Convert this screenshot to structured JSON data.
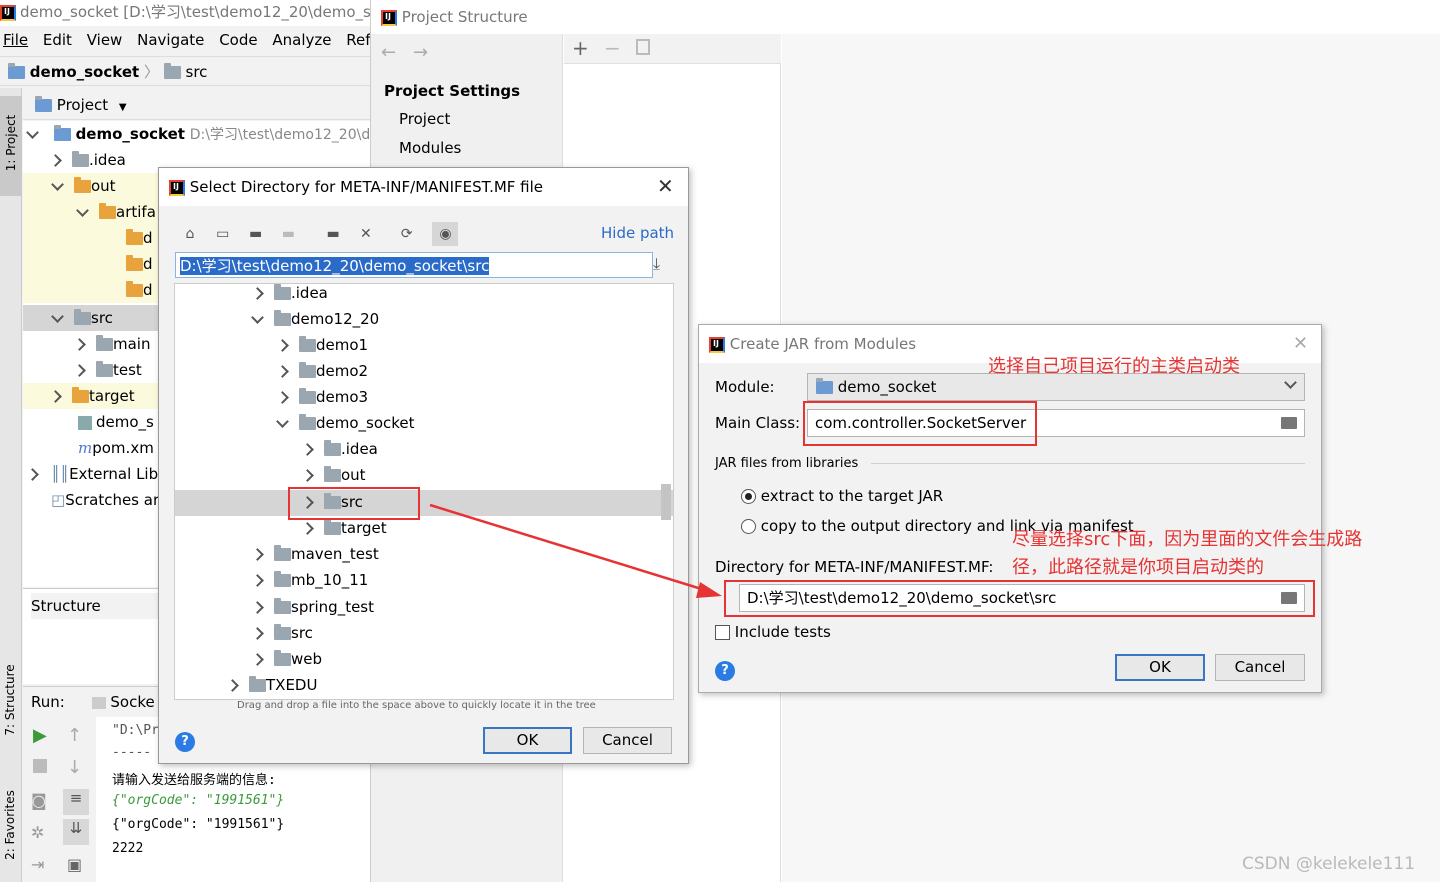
{
  "ide": {
    "title": "demo_socket [D:\\学习\\test\\demo12_20\\demo_s",
    "menu": [
      "File",
      "Edit",
      "View",
      "Navigate",
      "Code",
      "Analyze",
      "Ref"
    ],
    "breadcrumb_project": "demo_socket",
    "breadcrumb_folder": "src",
    "panel_title": "Project",
    "side_tabs": [
      "1: Project",
      "7: Structure",
      "2: Favorites"
    ],
    "tree_root": "demo_socket",
    "tree_root_path": "D:\\学习\\test\\demo12_20\\d",
    "tree": [
      ".idea",
      "out",
      "artifa",
      "d",
      "d",
      "d",
      "src",
      "main",
      "test",
      "target",
      "demo_s",
      "pom.xm",
      "External Lib",
      "Scratches ar"
    ],
    "structure_title": "Structure",
    "run_label": "Run:",
    "run_tab": "Socke",
    "console": [
      "\"D:\\Pr",
      "-----",
      "请输入发送给服务端的信息:",
      "{\"orgCode\": \"1991561\"}",
      "{\"orgCode\": \"1991561\"}",
      "2222"
    ]
  },
  "project_structure": {
    "title": "Project Structure",
    "section": "Project Settings",
    "items": [
      "Project",
      "Modules"
    ]
  },
  "select_dir": {
    "title": "Select Directory for META-INF/MANIFEST.MF file",
    "hide_path": "Hide path",
    "path": "D:\\学习\\test\\demo12_20\\demo_socket\\src",
    "tree": [
      ".idea",
      "demo12_20",
      "demo1",
      "demo2",
      "demo3",
      "demo_socket",
      ".idea",
      "out",
      "src",
      "target",
      "maven_test",
      "mb_10_11",
      "spring_test",
      "src",
      "web",
      "TXEDU"
    ],
    "hint": "Drag and drop a file into the space above to quickly locate it in the tree",
    "ok": "OK",
    "cancel": "Cancel"
  },
  "create_jar": {
    "title": "Create JAR from Modules",
    "module_label": "Module:",
    "module_value": "demo_socket",
    "main_class_label": "Main Class:",
    "main_class_value": "com.controller.SocketServer",
    "jar_files_label": "JAR files from libraries",
    "opt_extract": "extract to the target JAR",
    "opt_copy": "copy to the output directory and link via manifest",
    "dir_label": "Directory for META-INF/MANIFEST.MF:",
    "dir_value": "D:\\学习\\test\\demo12_20\\demo_socket\\src",
    "include_tests": "Include tests",
    "ok": "OK",
    "cancel": "Cancel"
  },
  "annotations": {
    "note1": "选择自己项目运行的主类启动类",
    "note2_line1": "尽量选择src下面，因为里面的文件会生成路",
    "note2_line2": "径，此路径就是你项目启动类的"
  },
  "watermark": "CSDN @kelekele111"
}
